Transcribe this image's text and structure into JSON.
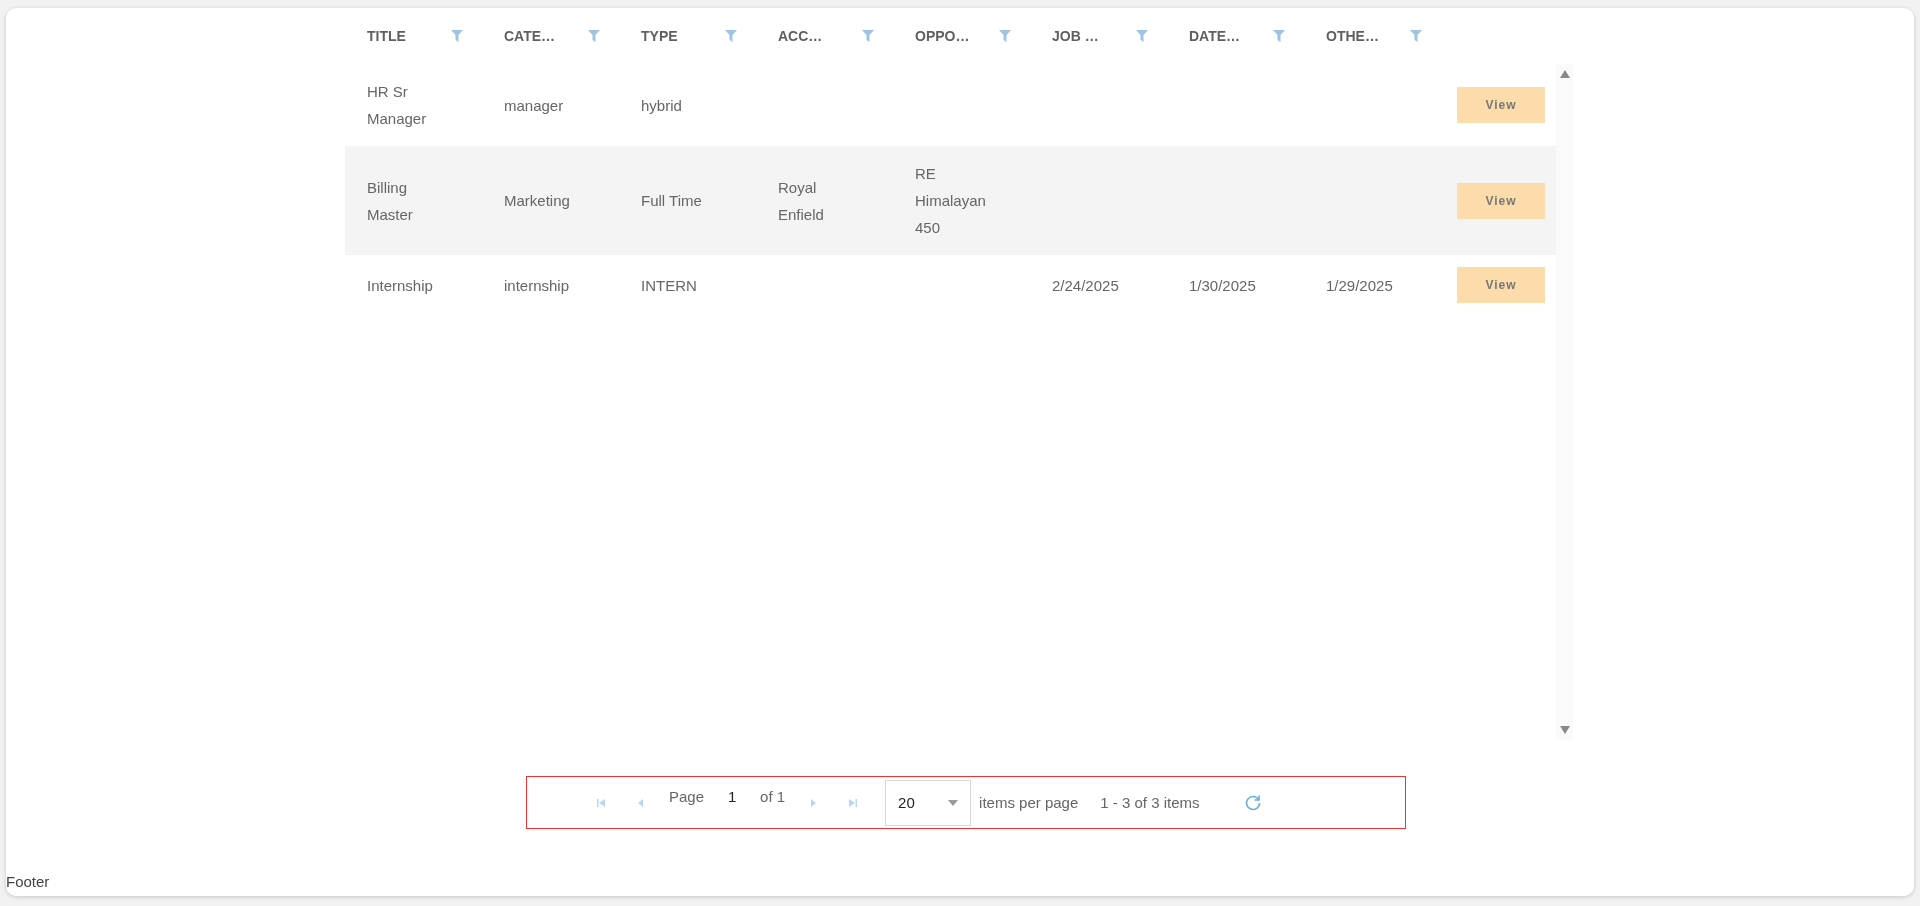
{
  "table": {
    "columns": [
      {
        "label": "TITLE"
      },
      {
        "label": "CATE…"
      },
      {
        "label": "TYPE"
      },
      {
        "label": "ACC…"
      },
      {
        "label": "OPPO…"
      },
      {
        "label": "JOB …"
      },
      {
        "label": "DATE…"
      },
      {
        "label": "OTHE…"
      }
    ],
    "rows": [
      {
        "cells": [
          "HR Sr Manager",
          "manager",
          "hybrid",
          null,
          null,
          null,
          null,
          null
        ],
        "action": "View"
      },
      {
        "cells": [
          "Billing Master",
          "Marketing",
          "Full Time",
          "Royal Enfield",
          "RE Himalayan 450",
          null,
          null,
          null
        ],
        "action": "View"
      },
      {
        "cells": [
          "Internship",
          "internship",
          "INTERN",
          null,
          null,
          "2/24/2025",
          "1/30/2025",
          "1/29/2025"
        ],
        "action": "View"
      }
    ]
  },
  "pager": {
    "nav": [
      {
        "kind": "first",
        "disabled": true
      },
      {
        "kind": "prev",
        "disabled": true
      },
      {
        "kind": "next",
        "disabled": true
      },
      {
        "kind": "last",
        "disabled": true
      }
    ],
    "page_label": "Page",
    "page_value": "1",
    "page_total": "of 1",
    "page_size": "20",
    "page_size_label": "items per page",
    "summary": "1 - 3 of 3 items"
  },
  "footer": "Footer"
}
